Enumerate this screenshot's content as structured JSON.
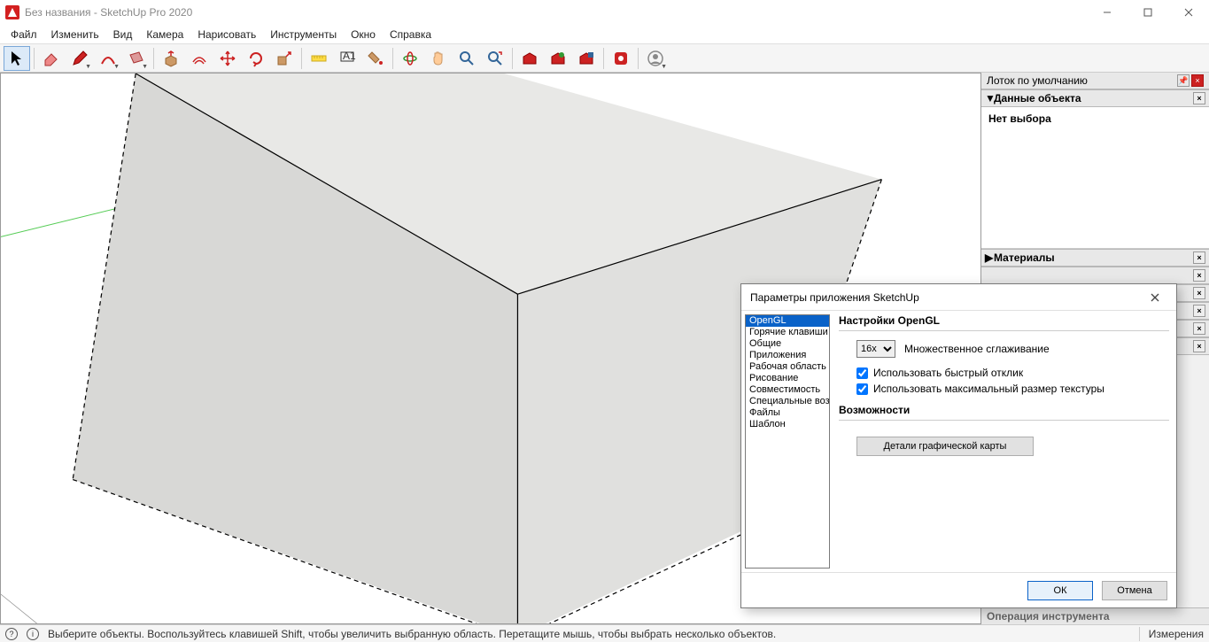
{
  "window": {
    "title": "Без названия - SketchUp Pro 2020"
  },
  "menu": {
    "items": [
      "Файл",
      "Изменить",
      "Вид",
      "Камера",
      "Нарисовать",
      "Инструменты",
      "Окно",
      "Справка"
    ]
  },
  "toolbar_icons": [
    "select",
    "eraser",
    "pencil",
    "arc",
    "rectangle",
    "pushpull",
    "offset",
    "move",
    "rotate",
    "scale",
    "tape",
    "text",
    "paint",
    "orbit",
    "pan",
    "zoom",
    "zoom-extents",
    "warehouse-a",
    "warehouse-b",
    "warehouse-c",
    "extension",
    "user"
  ],
  "tray": {
    "title": "Лоток по умолчанию",
    "panel_entity": {
      "title": "Данные объекта",
      "body": "Нет выбора"
    },
    "panel_materials": "Материалы",
    "hidden_panels_count": 5,
    "footer": "Операция инструмента"
  },
  "dialog": {
    "title": "Параметры приложения SketchUp",
    "categories": [
      "OpenGL",
      "Горячие клавиши",
      "Общие",
      "Приложения",
      "Рабочая область",
      "Рисование",
      "Совместимость",
      "Специальные возможности",
      "Файлы",
      "Шаблон"
    ],
    "selected_category": 0,
    "section1_title": "Настройки OpenGL",
    "aa_value": "16x",
    "aa_label": "Множественное сглаживание",
    "chk1": {
      "checked": true,
      "label": "Использовать быстрый отклик"
    },
    "chk2": {
      "checked": true,
      "label": "Использовать максимальный размер текстуры"
    },
    "section2_title": "Возможности",
    "details_btn": "Детали графической карты",
    "ok": "ОК",
    "cancel": "Отмена"
  },
  "status": {
    "hint": "Выберите объекты. Воспользуйтесь клавишей Shift, чтобы увеличить выбранную область. Перетащите мышь, чтобы выбрать несколько объектов.",
    "measurements_label": "Измерения"
  }
}
